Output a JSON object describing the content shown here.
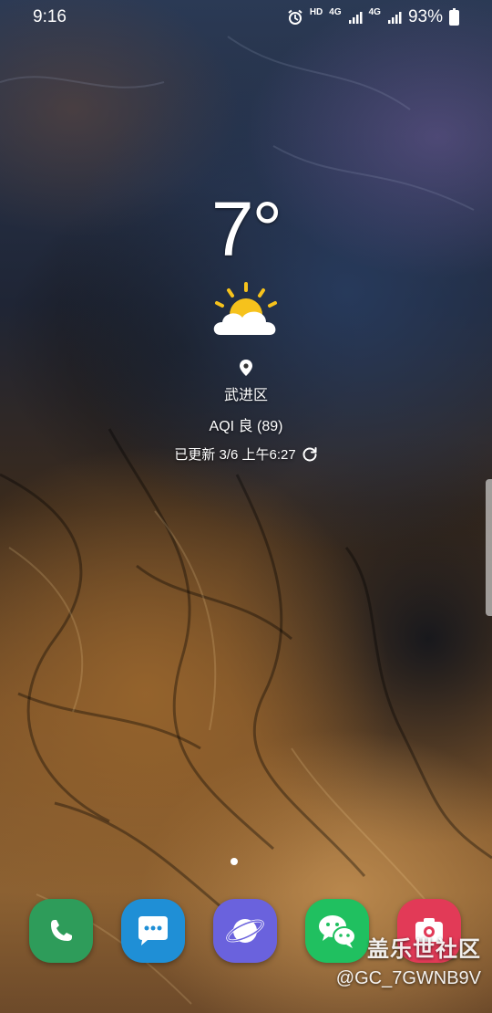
{
  "status_bar": {
    "time": "9:16",
    "hd_label": "HD",
    "network_1": "4G",
    "network_2": "4G",
    "battery_percent": "93%",
    "icons": [
      "alarm-icon",
      "signal-icon",
      "signal-icon",
      "battery-icon"
    ]
  },
  "weather": {
    "temperature": "7°",
    "condition_icon": "partly-sunny-icon",
    "location": "武进区",
    "aqi": "AQI 良 (89)",
    "updated": "已更新 3/6 上午6:27"
  },
  "home": {
    "page_count": 1,
    "current_page": 1
  },
  "dock": {
    "apps": [
      {
        "name": "phone",
        "icon": "phone-icon",
        "color": "#2e9c5a"
      },
      {
        "name": "messages",
        "icon": "chat-bubble-icon",
        "color": "#1f8fd6"
      },
      {
        "name": "internet",
        "icon": "planet-icon",
        "color": "#6a62dd"
      },
      {
        "name": "wechat",
        "icon": "wechat-icon",
        "color": "#20c060"
      },
      {
        "name": "camera",
        "icon": "camera-icon",
        "color": "#e23a57"
      }
    ]
  },
  "watermark": {
    "title": "盖乐世社区",
    "user": "@GC_7GWNB9V"
  }
}
